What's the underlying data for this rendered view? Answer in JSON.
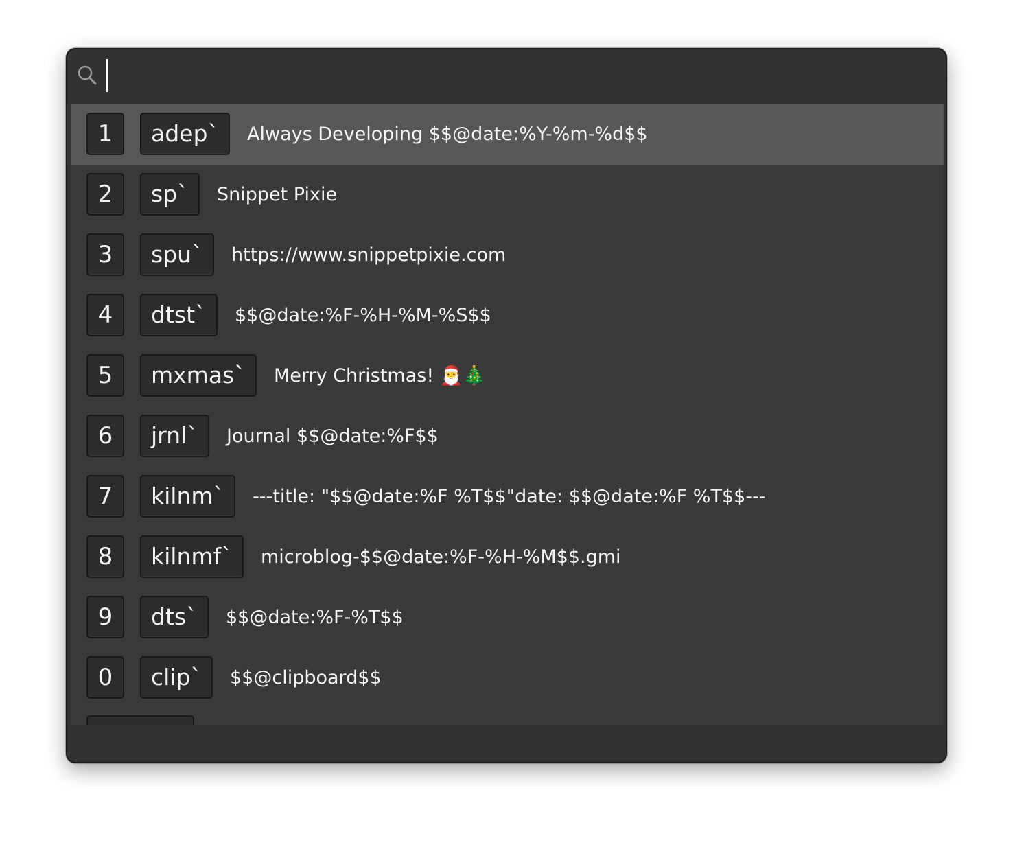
{
  "search": {
    "value": "",
    "placeholder": ""
  },
  "snippets": [
    {
      "number": "1",
      "abbreviation": "adep`",
      "text": "Always Developing $$@date:%Y-%m-%d$$",
      "selected": true
    },
    {
      "number": "2",
      "abbreviation": "sp`",
      "text": "Snippet Pixie",
      "selected": false
    },
    {
      "number": "3",
      "abbreviation": "spu`",
      "text": "https://www.snippetpixie.com",
      "selected": false
    },
    {
      "number": "4",
      "abbreviation": "dtst`",
      "text": "$$@date:%F-%H-%M-%S$$",
      "selected": false
    },
    {
      "number": "5",
      "abbreviation": "mxmas`",
      "text": "Merry Christmas! 🎅🎄",
      "selected": false
    },
    {
      "number": "6",
      "abbreviation": "jrnl`",
      "text": "Journal $$@date:%F$$",
      "selected": false
    },
    {
      "number": "7",
      "abbreviation": "kilnm`",
      "text": "---title: \"$$@date:%F %T$$\"date: $$@date:%F %T$$---",
      "selected": false
    },
    {
      "number": "8",
      "abbreviation": "kilnmf`",
      "text": "microblog-$$@date:%F-%H-%M$$.gmi",
      "selected": false
    },
    {
      "number": "9",
      "abbreviation": "dts`",
      "text": "$$@date:%F-%T$$",
      "selected": false
    },
    {
      "number": "0",
      "abbreviation": "clip`",
      "text": "$$@clipboard$$",
      "selected": false
    }
  ],
  "colors": {
    "window_bg": "#323232",
    "list_bg": "#393939",
    "selected_row_bg": "#575757",
    "keycap_bg": "#2c2c2c",
    "text": "#f4f4f4"
  },
  "icons": {
    "search": "search-icon"
  }
}
